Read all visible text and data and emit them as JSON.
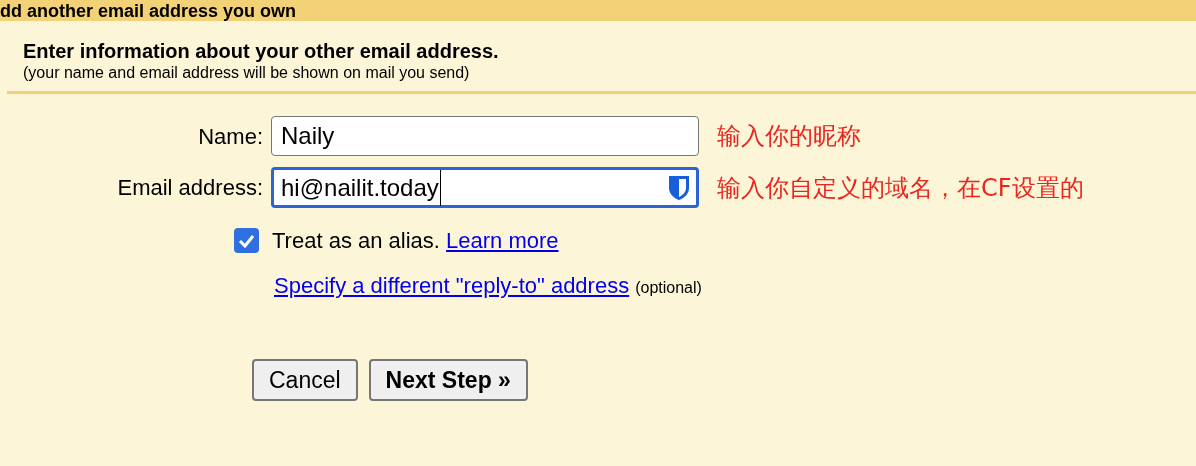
{
  "header": {
    "title": "dd another email address you own"
  },
  "section": {
    "heading": "Enter information about your other email address.",
    "subheading": "(your name and email address will be shown on mail you send)"
  },
  "fields": [
    {
      "label": "Name:",
      "value": "Naily",
      "focused": false,
      "annotation": "输入你的昵称"
    },
    {
      "label": "Email address:",
      "value": "hi@nailit.today",
      "focused": true,
      "annotation": "输入你自定义的域名，在CF设置的"
    }
  ],
  "alias": {
    "checked": true,
    "label": "Treat as an alias.",
    "link": "Learn more"
  },
  "reply_to": {
    "link": "Specify a different \"reply-to\" address",
    "note": "(optional)"
  },
  "buttons": [
    {
      "label": "Cancel",
      "primary": false
    },
    {
      "label": "Next Step »",
      "primary": true
    }
  ]
}
